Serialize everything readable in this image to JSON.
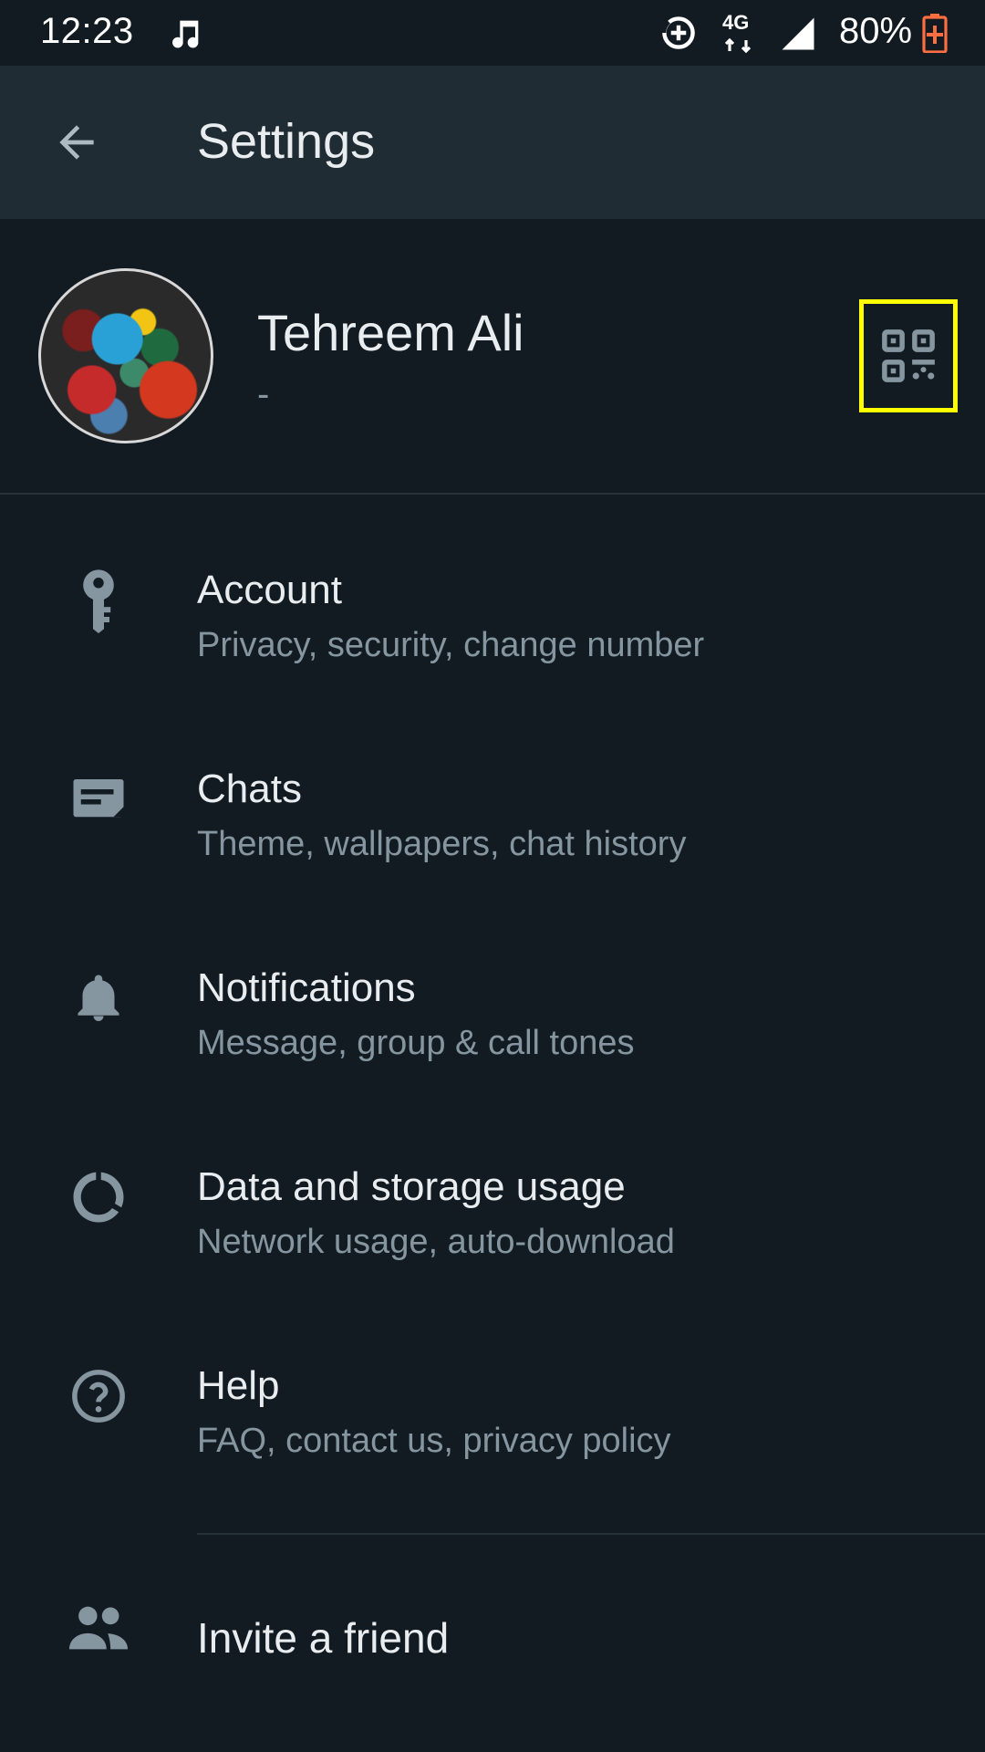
{
  "status_bar": {
    "time": "12:23",
    "network_type": "4G",
    "battery_percent": "80%",
    "icons": [
      "music-note-icon",
      "sync-icon",
      "network-4g-icon",
      "signal-icon",
      "battery-charging-icon"
    ]
  },
  "app_bar": {
    "title": "Settings",
    "back_icon": "arrow-back-icon"
  },
  "profile": {
    "name": "Tehreem Ali",
    "about": "-",
    "qr_icon": "qr-code-icon",
    "highlight_color": "#ffff00"
  },
  "settings": {
    "items": [
      {
        "title": "Account",
        "subtitle": "Privacy, security, change number",
        "icon": "key-icon"
      },
      {
        "title": "Chats",
        "subtitle": "Theme, wallpapers, chat history",
        "icon": "chat-icon"
      },
      {
        "title": "Notifications",
        "subtitle": "Message, group & call tones",
        "icon": "bell-icon"
      },
      {
        "title": "Data and storage usage",
        "subtitle": "Network usage, auto-download",
        "icon": "data-usage-icon"
      },
      {
        "title": "Help",
        "subtitle": "FAQ, contact us, privacy policy",
        "icon": "help-icon"
      }
    ],
    "invite": {
      "title": "Invite a friend",
      "icon": "people-icon"
    }
  },
  "colors": {
    "background": "#121b22",
    "app_bar": "#202c33",
    "primary_text": "#e9edef",
    "secondary_text": "#8696a0",
    "icon": "#8696a0"
  }
}
